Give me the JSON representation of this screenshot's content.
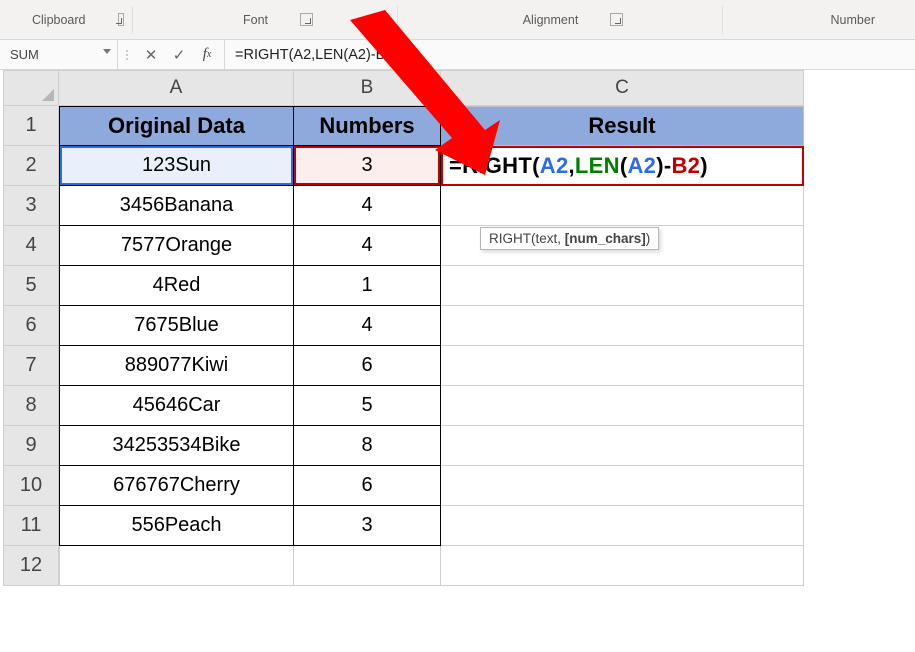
{
  "ribbon": {
    "groups": [
      "Clipboard",
      "Font",
      "Alignment",
      "Number"
    ]
  },
  "namebox": "SUM",
  "formula_bar": "=RIGHT(A2,LEN(A2)-B2)",
  "tooltip": {
    "fn": "RIGHT",
    "args": "(text, [num_chars])"
  },
  "columns": [
    "A",
    "B",
    "C"
  ],
  "headers": {
    "A": "Original Data",
    "B": "Numbers",
    "C": "Result"
  },
  "rows": [
    {
      "n": 1
    },
    {
      "n": 2
    },
    {
      "n": 3
    },
    {
      "n": 4
    },
    {
      "n": 5
    },
    {
      "n": 6
    },
    {
      "n": 7
    },
    {
      "n": 8
    },
    {
      "n": 9
    },
    {
      "n": 10
    },
    {
      "n": 11
    },
    {
      "n": 12
    }
  ],
  "data": [
    {
      "a": "123Sun",
      "b": "3"
    },
    {
      "a": "3456Banana",
      "b": "4"
    },
    {
      "a": "7577Orange",
      "b": "4"
    },
    {
      "a": "4Red",
      "b": "1"
    },
    {
      "a": "7675Blue",
      "b": "4"
    },
    {
      "a": "889077Kiwi",
      "b": "6"
    },
    {
      "a": "45646Car",
      "b": "5"
    },
    {
      "a": "34253534Bike",
      "b": "8"
    },
    {
      "a": "676767Cherry",
      "b": "6"
    },
    {
      "a": "556Peach",
      "b": "3"
    }
  ],
  "formula_cell": {
    "eq": "=",
    "right": "RIGHT",
    "open": "(",
    "a2": "A2",
    "comma": ",",
    "len": "LEN",
    "open2": "(",
    "a2b": "A2",
    "close2": ")",
    "minus": "-",
    "b2": "B2",
    "close": ")"
  }
}
